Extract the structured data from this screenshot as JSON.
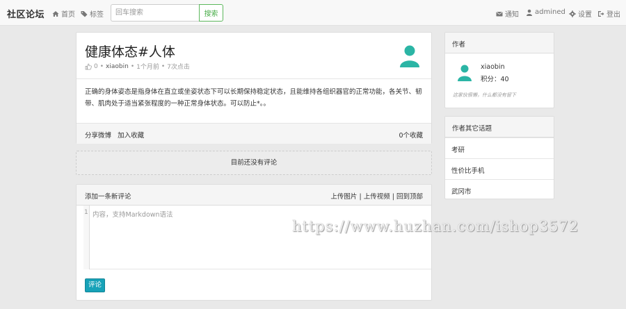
{
  "colors": {
    "accent": "#2bb5a5",
    "primary_btn": "#17a2b8",
    "search_btn": "#4cae4c"
  },
  "navbar": {
    "brand": "社区论坛",
    "home": "首页",
    "tags": "标签",
    "search_placeholder": "回车搜索",
    "search_button": "搜索",
    "notify": "通知",
    "user": "admined",
    "settings": "设置",
    "logout": "登出"
  },
  "post": {
    "title": "健康体态#人体",
    "like_count": "0",
    "author": "xiaobin",
    "time": "1个月前",
    "views": "7次点击",
    "body": "正确的身体姿态是指身体在直立或坐姿状态下可以长期保持稳定状态，且能维持各组织器官的正常功能，各关节、韧带、肌肉处于适当紧张程度的一种正常身体状态。可以防止*。。",
    "share": "分享微博",
    "favorite": "加入收藏",
    "favorite_count": "0个收藏"
  },
  "comments": {
    "empty_text": "目前还没有评论"
  },
  "comment_form": {
    "title": "添加一条新评论",
    "upload_image": "上传图片",
    "upload_video": "上传视频",
    "back_top": "回到顶部",
    "line_number": "1",
    "placeholder": "内容，支持Markdown语法",
    "submit": "评论"
  },
  "sidebar": {
    "author_title": "作者",
    "author_name": "xiaobin",
    "score_label": "积分：",
    "score": "40",
    "signature": "这家伙很懒，什么都没有留下",
    "topics_title": "作者其它话题",
    "topics": [
      "考研",
      "性价比手机",
      "武冈市"
    ]
  },
  "watermark": "https://www.huzhan.com/ishop3572"
}
